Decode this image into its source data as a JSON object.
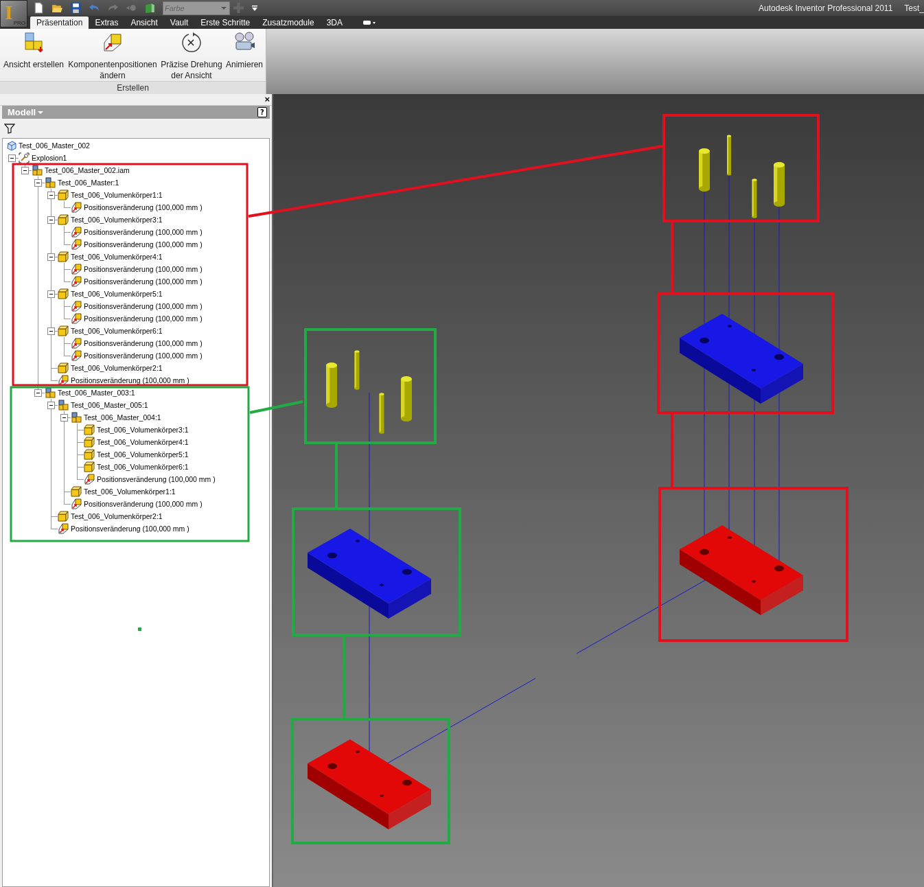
{
  "app_button": {
    "logo": "I",
    "badge": "PRO"
  },
  "quick_access": {
    "color_field": {
      "placeholder": "Farbe"
    }
  },
  "title_bar": {
    "app_title": "Autodesk Inventor Professional 2011",
    "document_title": "Test_"
  },
  "ribbon": {
    "tabs": [
      {
        "label": "Präsentation",
        "selected": true
      },
      {
        "label": "Extras",
        "selected": false
      },
      {
        "label": "Ansicht",
        "selected": false
      },
      {
        "label": "Vault",
        "selected": false
      },
      {
        "label": "Erste Schritte",
        "selected": false
      },
      {
        "label": "Zusatzmodule",
        "selected": false
      },
      {
        "label": "3DA",
        "selected": false
      }
    ],
    "panel": {
      "title": "Erstellen",
      "buttons": [
        {
          "label": "Ansicht erstellen",
          "kind": "create_view"
        },
        {
          "label": "Komponentenpositionen ändern",
          "kind": "tweak"
        },
        {
          "label": "Präzise Drehung der Ansicht",
          "kind": "rotate"
        },
        {
          "label": "Animieren",
          "kind": "animate"
        }
      ]
    }
  },
  "browser": {
    "close": "×",
    "title": "Modell",
    "help": "?",
    "tree": [
      {
        "label": "Test_006_Master_002",
        "kind": "root"
      },
      {
        "label": "Explosion1",
        "kind": "explosion",
        "expanded": true,
        "children": [
          {
            "label": "Test_006_Master_002.iam",
            "kind": "assembly",
            "expanded": true,
            "children": [
              {
                "label": "Test_006_Master:1",
                "kind": "assembly",
                "expanded": true,
                "children": [
                  {
                    "label": "Test_006_Volumenkörper1:1",
                    "kind": "part",
                    "expanded": true,
                    "children": [
                      {
                        "label": "Positionsveränderung (100,000 mm )",
                        "kind": "tweak"
                      }
                    ]
                  },
                  {
                    "label": "Test_006_Volumenkörper3:1",
                    "kind": "part",
                    "expanded": true,
                    "children": [
                      {
                        "label": "Positionsveränderung (100,000 mm )",
                        "kind": "tweak"
                      },
                      {
                        "label": "Positionsveränderung (100,000 mm )",
                        "kind": "tweak"
                      }
                    ]
                  },
                  {
                    "label": "Test_006_Volumenkörper4:1",
                    "kind": "part",
                    "expanded": true,
                    "children": [
                      {
                        "label": "Positionsveränderung (100,000 mm )",
                        "kind": "tweak"
                      },
                      {
                        "label": "Positionsveränderung (100,000 mm )",
                        "kind": "tweak"
                      }
                    ]
                  },
                  {
                    "label": "Test_006_Volumenkörper5:1",
                    "kind": "part",
                    "expanded": true,
                    "children": [
                      {
                        "label": "Positionsveränderung (100,000 mm )",
                        "kind": "tweak"
                      },
                      {
                        "label": "Positionsveränderung (100,000 mm )",
                        "kind": "tweak"
                      }
                    ]
                  },
                  {
                    "label": "Test_006_Volumenkörper6:1",
                    "kind": "part",
                    "expanded": true,
                    "children": [
                      {
                        "label": "Positionsveränderung (100,000 mm )",
                        "kind": "tweak"
                      },
                      {
                        "label": "Positionsveränderung (100,000 mm )",
                        "kind": "tweak"
                      }
                    ]
                  },
                  {
                    "label": "Test_006_Volumenkörper2:1",
                    "kind": "part"
                  },
                  {
                    "label": "Positionsveränderung (100,000 mm )",
                    "kind": "tweak"
                  }
                ]
              },
              {
                "label": "Test_006_Master_003:1",
                "kind": "assembly",
                "expanded": true,
                "children": [
                  {
                    "label": "Test_006_Master_005:1",
                    "kind": "assembly",
                    "expanded": true,
                    "children": [
                      {
                        "label": "Test_006_Master_004:1",
                        "kind": "assembly",
                        "expanded": true,
                        "children": [
                          {
                            "label": "Test_006_Volumenkörper3:1",
                            "kind": "part"
                          },
                          {
                            "label": "Test_006_Volumenkörper4:1",
                            "kind": "part"
                          },
                          {
                            "label": "Test_006_Volumenkörper5:1",
                            "kind": "part"
                          },
                          {
                            "label": "Test_006_Volumenkörper6:1",
                            "kind": "part"
                          },
                          {
                            "label": "Positionsveränderung (100,000 mm )",
                            "kind": "tweak"
                          }
                        ]
                      },
                      {
                        "label": "Test_006_Volumenkörper1:1",
                        "kind": "part"
                      },
                      {
                        "label": "Positionsveränderung (100,000 mm )",
                        "kind": "tweak"
                      }
                    ]
                  },
                  {
                    "label": "Test_006_Volumenkörper2:1",
                    "kind": "part"
                  },
                  {
                    "label": "Positionsveränderung (100,000 mm )",
                    "kind": "tweak"
                  }
                ]
              }
            ]
          }
        ]
      }
    ]
  }
}
